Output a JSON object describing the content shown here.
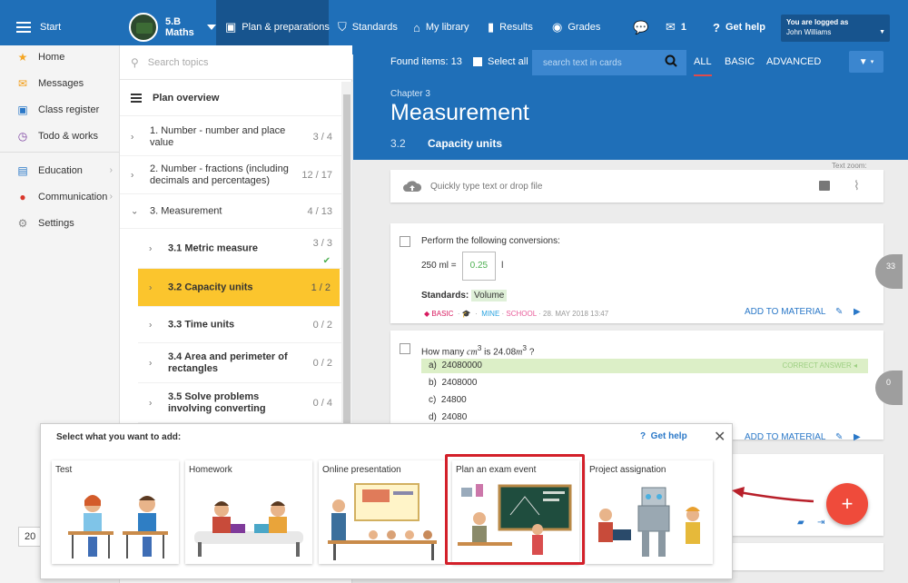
{
  "topbar": {
    "start_label": "Start",
    "class_line1": "5.B",
    "class_line2": "Maths",
    "nav": [
      {
        "label": "Plan & preparations",
        "icon": "briefcase-icon"
      },
      {
        "label": "Standards",
        "icon": "shield-icon"
      },
      {
        "label": "My library",
        "icon": "library-icon"
      },
      {
        "label": "Results",
        "icon": "bar-chart-icon"
      },
      {
        "label": "Grades",
        "icon": "grades-icon"
      }
    ],
    "messages_count": "1",
    "get_help": "Get help",
    "user_caption": "You are logged as",
    "user_name": "John Williams"
  },
  "sidebar": {
    "items": [
      {
        "label": "Home",
        "icon": "star-icon"
      },
      {
        "label": "Messages",
        "icon": "envelope-icon"
      },
      {
        "label": "Class register",
        "icon": "register-icon"
      },
      {
        "label": "Todo & works",
        "icon": "clock-icon"
      },
      {
        "label": "Education",
        "icon": "education-icon"
      },
      {
        "label": "Communication",
        "icon": "chat-icon"
      },
      {
        "label": "Settings",
        "icon": "gear-icon"
      }
    ],
    "year_value": "20"
  },
  "topics": {
    "search_placeholder": "Search topics",
    "overview_label": "Plan overview",
    "items": [
      {
        "label": "1. Number - number and place value",
        "count": "3 / 4"
      },
      {
        "label": "2. Number - fractions (including decimals and percentages)",
        "count": "12 / 17"
      },
      {
        "label": "3. Measurement",
        "count": "4 / 13"
      },
      {
        "label": "3.1  Metric measure",
        "count": "3 / 3"
      },
      {
        "label": "3.2  Capacity units",
        "count": "1 / 2"
      },
      {
        "label": "3.3  Time units",
        "count": "0 / 2"
      },
      {
        "label": "3.4  Area and perimeter of rectangles",
        "count": "0 / 2"
      },
      {
        "label": "3.5  Solve problems involving converting",
        "count": "0 / 4"
      }
    ]
  },
  "main": {
    "found_label": "Found items: 13",
    "select_all": "Select all",
    "search_placeholder": "search text in cards",
    "filters": [
      "ALL",
      "BASIC",
      "ADVANCED"
    ],
    "chapter": "Chapter 3",
    "title": "Measurement",
    "sub_num": "3.2",
    "sub_title": "Capacity units",
    "text_zoom": "Text zoom:",
    "quick_placeholder": "Quickly type text or drop file"
  },
  "cards": [
    {
      "question": "Perform the following conversions:",
      "ans_prefix": "250 ml =",
      "ans_value": "0.25",
      "ans_unit": "l",
      "standards_label": "Standards:",
      "standard": "Volume",
      "meta_basic": "BASIC",
      "meta_mine": "MINE",
      "meta_school": "SCHOOL",
      "meta_date": "28. MAY 2018 13:47",
      "add_label": "ADD TO MATERIAL",
      "side_badge": "33"
    },
    {
      "q_prefix": "How many",
      "q_unit1": "cm",
      "q_mid": "is 24.08",
      "q_unit2": "m",
      "q_suffix": "?",
      "options": [
        {
          "letter": "a)",
          "value": "24080000"
        },
        {
          "letter": "b)",
          "value": "2408000"
        },
        {
          "letter": "c)",
          "value": "24800"
        },
        {
          "letter": "d)",
          "value": "24080"
        }
      ],
      "correct_label": "CORRECT ANSWER",
      "add_label": "ADD TO MATERIAL",
      "side_badge": "0"
    }
  ],
  "sheet": {
    "title": "Select what you want to add:",
    "help": "Get help",
    "options": [
      "Test",
      "Homework",
      "Online presentation",
      "Plan an exam event",
      "Project assignation"
    ]
  },
  "colors": {
    "primary": "#1f6fb8",
    "active_topic": "#fbc52d",
    "highlight": "#d3202a",
    "fab": "#ef4b3b"
  }
}
